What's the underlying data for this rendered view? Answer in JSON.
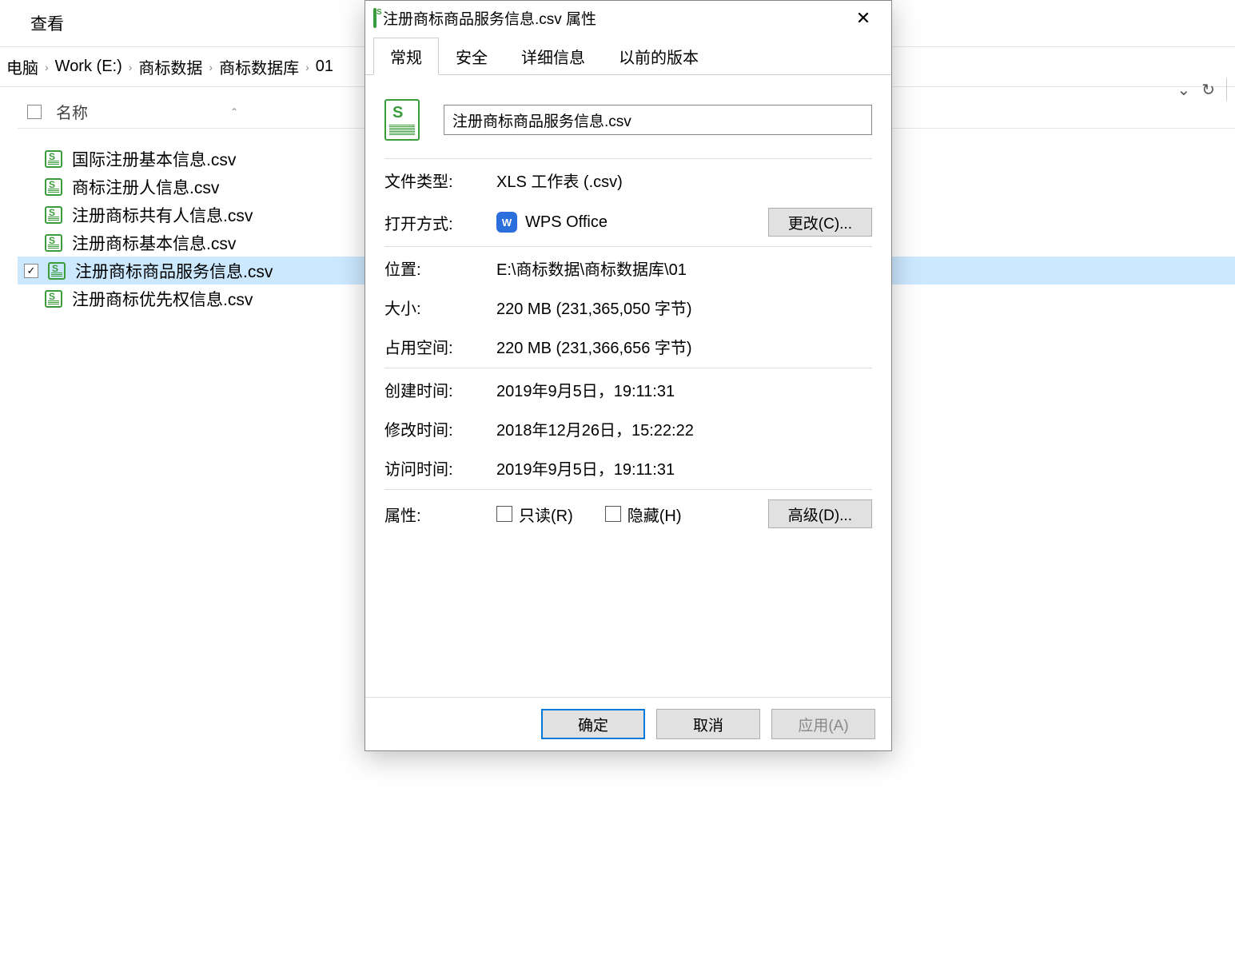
{
  "explorer": {
    "menu_view": "查看",
    "breadcrumb": [
      "电脑",
      "Work (E:)",
      "商标数据",
      "商标数据库",
      "01"
    ],
    "column_name": "名称",
    "files": [
      "国际注册基本信息.csv",
      "商标注册人信息.csv",
      "注册商标共有人信息.csv",
      "注册商标基本信息.csv",
      "注册商标商品服务信息.csv",
      "注册商标优先权信息.csv"
    ],
    "selected_index": 4
  },
  "dialog": {
    "title": "注册商标商品服务信息.csv 属性",
    "tabs": [
      "常规",
      "安全",
      "详细信息",
      "以前的版本"
    ],
    "active_tab": 0,
    "filename": "注册商标商品服务信息.csv",
    "labels": {
      "file_type": "文件类型:",
      "open_with": "打开方式:",
      "location": "位置:",
      "size": "大小:",
      "size_on_disk": "占用空间:",
      "created": "创建时间:",
      "modified": "修改时间:",
      "accessed": "访问时间:",
      "attributes": "属性:"
    },
    "values": {
      "file_type": "XLS 工作表 (.csv)",
      "open_with": "WPS Office",
      "location": "E:\\商标数据\\商标数据库\\01",
      "size": "220 MB (231,365,050 字节)",
      "size_on_disk": "220 MB (231,366,656 字节)",
      "created": "2019年9月5日，19:11:31",
      "modified": "2018年12月26日，15:22:22",
      "accessed": "2019年9月5日，19:11:31"
    },
    "buttons": {
      "change": "更改(C)...",
      "advanced": "高级(D)...",
      "ok": "确定",
      "cancel": "取消",
      "apply": "应用(A)"
    },
    "checkboxes": {
      "readonly": "只读(R)",
      "hidden": "隐藏(H)"
    }
  }
}
